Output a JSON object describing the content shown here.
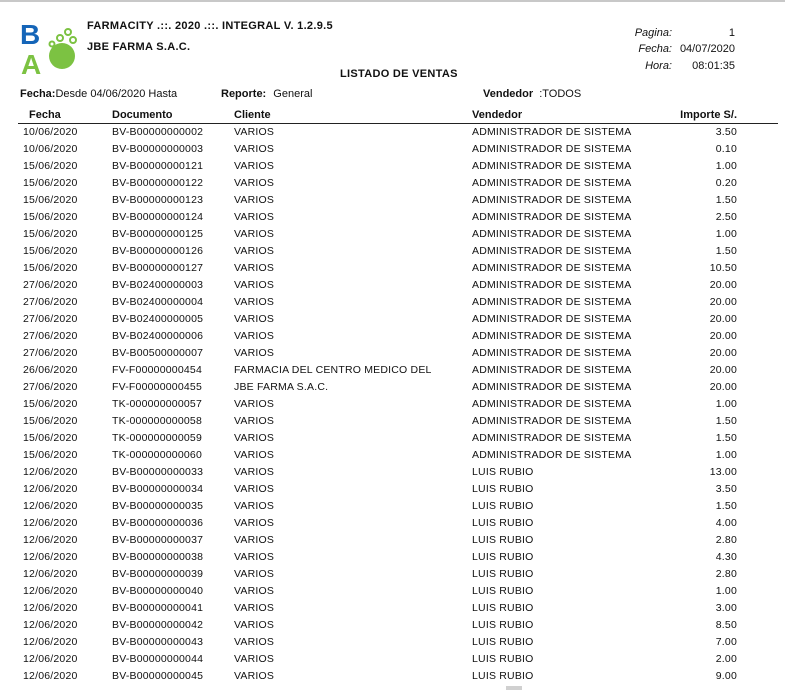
{
  "header": {
    "app_title": "FARMACITY .::. 2020 .::.  INTEGRAL  V.  1.2.9.5",
    "company": "JBE FARMA S.A.C.",
    "report_title": "LISTADO DE VENTAS",
    "pagina_label": "Pagina:",
    "pagina_value": "1",
    "fecha_label": "Fecha:",
    "fecha_value": "04/07/2020",
    "hora_label": "Hora:",
    "hora_value": "08:01:35"
  },
  "logo": {
    "letters": [
      "B",
      "A"
    ],
    "colors": {
      "blue": "#1565b8",
      "green": "#7cc242"
    }
  },
  "filters": {
    "fecha_label": "Fecha:",
    "fecha_value": "Desde 04/06/2020 Hasta",
    "reporte_label": "Reporte:",
    "reporte_value": "General",
    "vendedor_label": "Vendedor",
    "vendedor_value": ":TODOS"
  },
  "table": {
    "columns": [
      "Fecha",
      "Documento",
      "Cliente",
      "Vendedor",
      "Importe S/."
    ],
    "rows": [
      [
        "10/06/2020",
        "BV-B00000000002",
        "VARIOS",
        "ADMINISTRADOR DE SISTEMA",
        "3.50"
      ],
      [
        "10/06/2020",
        "BV-B00000000003",
        "VARIOS",
        "ADMINISTRADOR DE SISTEMA",
        "0.10"
      ],
      [
        "15/06/2020",
        "BV-B00000000121",
        "VARIOS",
        "ADMINISTRADOR DE SISTEMA",
        "1.00"
      ],
      [
        "15/06/2020",
        "BV-B00000000122",
        "VARIOS",
        "ADMINISTRADOR DE SISTEMA",
        "0.20"
      ],
      [
        "15/06/2020",
        "BV-B00000000123",
        "VARIOS",
        "ADMINISTRADOR DE SISTEMA",
        "1.50"
      ],
      [
        "15/06/2020",
        "BV-B00000000124",
        "VARIOS",
        "ADMINISTRADOR DE SISTEMA",
        "2.50"
      ],
      [
        "15/06/2020",
        "BV-B00000000125",
        "VARIOS",
        "ADMINISTRADOR DE SISTEMA",
        "1.00"
      ],
      [
        "15/06/2020",
        "BV-B00000000126",
        "VARIOS",
        "ADMINISTRADOR DE SISTEMA",
        "1.50"
      ],
      [
        "15/06/2020",
        "BV-B00000000127",
        "VARIOS",
        "ADMINISTRADOR DE SISTEMA",
        "10.50"
      ],
      [
        "27/06/2020",
        "BV-B02400000003",
        "VARIOS",
        "ADMINISTRADOR DE SISTEMA",
        "20.00"
      ],
      [
        "27/06/2020",
        "BV-B02400000004",
        "VARIOS",
        "ADMINISTRADOR DE SISTEMA",
        "20.00"
      ],
      [
        "27/06/2020",
        "BV-B02400000005",
        "VARIOS",
        "ADMINISTRADOR DE SISTEMA",
        "20.00"
      ],
      [
        "27/06/2020",
        "BV-B02400000006",
        "VARIOS",
        "ADMINISTRADOR DE SISTEMA",
        "20.00"
      ],
      [
        "27/06/2020",
        "BV-B00500000007",
        "VARIOS",
        "ADMINISTRADOR DE SISTEMA",
        "20.00"
      ],
      [
        "26/06/2020",
        "FV-F00000000454",
        "FARMACIA DEL CENTRO MEDICO DEL",
        "ADMINISTRADOR DE SISTEMA",
        "20.00"
      ],
      [
        "27/06/2020",
        "FV-F00000000455",
        "JBE FARMA S.A.C.",
        "ADMINISTRADOR DE SISTEMA",
        "20.00"
      ],
      [
        "15/06/2020",
        "TK-000000000057",
        "VARIOS",
        "ADMINISTRADOR DE SISTEMA",
        "1.00"
      ],
      [
        "15/06/2020",
        "TK-000000000058",
        "VARIOS",
        "ADMINISTRADOR DE SISTEMA",
        "1.50"
      ],
      [
        "15/06/2020",
        "TK-000000000059",
        "VARIOS",
        "ADMINISTRADOR DE SISTEMA",
        "1.50"
      ],
      [
        "15/06/2020",
        "TK-000000000060",
        "VARIOS",
        "ADMINISTRADOR DE SISTEMA",
        "1.00"
      ],
      [
        "12/06/2020",
        "BV-B00000000033",
        "VARIOS",
        "LUIS RUBIO",
        "13.00"
      ],
      [
        "12/06/2020",
        "BV-B00000000034",
        "VARIOS",
        "LUIS RUBIO",
        "3.50"
      ],
      [
        "12/06/2020",
        "BV-B00000000035",
        "VARIOS",
        "LUIS RUBIO",
        "1.50"
      ],
      [
        "12/06/2020",
        "BV-B00000000036",
        "VARIOS",
        "LUIS RUBIO",
        "4.00"
      ],
      [
        "12/06/2020",
        "BV-B00000000037",
        "VARIOS",
        "LUIS RUBIO",
        "2.80"
      ],
      [
        "12/06/2020",
        "BV-B00000000038",
        "VARIOS",
        "LUIS RUBIO",
        "4.30"
      ],
      [
        "12/06/2020",
        "BV-B00000000039",
        "VARIOS",
        "LUIS RUBIO",
        "2.80"
      ],
      [
        "12/06/2020",
        "BV-B00000000040",
        "VARIOS",
        "LUIS RUBIO",
        "1.00"
      ],
      [
        "12/06/2020",
        "BV-B00000000041",
        "VARIOS",
        "LUIS RUBIO",
        "3.00"
      ],
      [
        "12/06/2020",
        "BV-B00000000042",
        "VARIOS",
        "LUIS RUBIO",
        "8.50"
      ],
      [
        "12/06/2020",
        "BV-B00000000043",
        "VARIOS",
        "LUIS RUBIO",
        "7.00"
      ],
      [
        "12/06/2020",
        "BV-B00000000044",
        "VARIOS",
        "LUIS RUBIO",
        "2.00"
      ],
      [
        "12/06/2020",
        "BV-B00000000045",
        "VARIOS",
        "LUIS RUBIO",
        "9.00"
      ]
    ]
  }
}
